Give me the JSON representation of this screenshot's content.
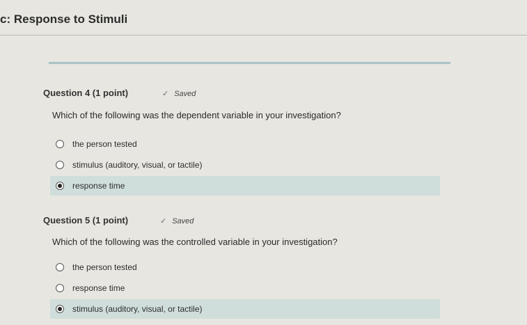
{
  "page": {
    "title": "c: Response to Stimuli"
  },
  "progress": {
    "fill_fraction": 1.0,
    "color": "#a9c3c7"
  },
  "questions": [
    {
      "header": "Question 4 (1 point)",
      "status": "Saved",
      "text": "Which of the following was the dependent variable in your investigation?",
      "options": [
        {
          "label": "the person tested",
          "selected": false
        },
        {
          "label": "stimulus (auditory, visual, or tactile)",
          "selected": false
        },
        {
          "label": "response time",
          "selected": true
        }
      ]
    },
    {
      "header": "Question 5 (1 point)",
      "status": "Saved",
      "text": "Which of the following was the controlled variable in your investigation?",
      "options": [
        {
          "label": "the person tested",
          "selected": false
        },
        {
          "label": "response time",
          "selected": false
        },
        {
          "label": "stimulus (auditory, visual, or tactile)",
          "selected": true
        }
      ]
    }
  ],
  "colors": {
    "background": "#e7e6e1",
    "selected_highlight": "#cfdedb"
  }
}
